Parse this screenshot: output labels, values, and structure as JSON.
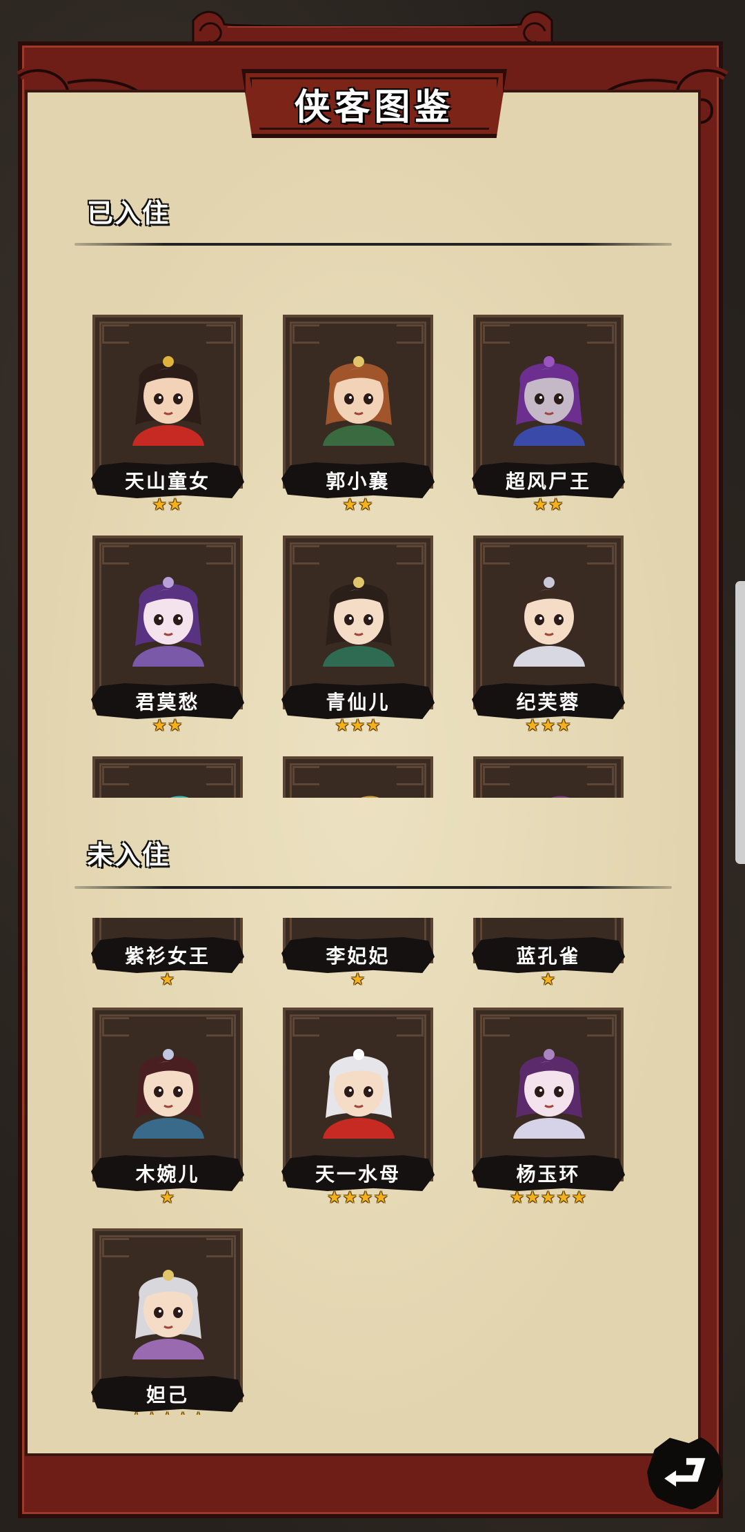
{
  "title": "侠客图鉴",
  "sections": {
    "joined_label": "已入住",
    "not_joined_label": "未入住"
  },
  "joined": [
    {
      "name": "天山童女",
      "stars": "★★",
      "hair": "#2c1d19",
      "skin": "#f3d3b8",
      "cloth": "#c62a23",
      "accent": "#e0b43a"
    },
    {
      "name": "郭小襄",
      "stars": "★★",
      "hair": "#a0552a",
      "skin": "#f3d3b8",
      "cloth": "#3a6a3f",
      "accent": "#e0c56a"
    },
    {
      "name": "超风尸王",
      "stars": "★★",
      "hair": "#6c2f8f",
      "skin": "#c6b9c7",
      "cloth": "#3a4aa8",
      "accent": "#9b55c0"
    },
    {
      "name": "君莫愁",
      "stars": "★★",
      "hair": "#5a3282",
      "skin": "#f4e2ec",
      "cloth": "#7a5aa8",
      "accent": "#b9a0d8"
    },
    {
      "name": "青仙儿",
      "stars": "★★★",
      "hair": "#2b1f1a",
      "skin": "#f5dcc6",
      "cloth": "#2f6b52",
      "accent": "#e0c56a"
    },
    {
      "name": "纪芙蓉",
      "stars": "★★★",
      "hair": "#3a2a22",
      "skin": "#f5dcc6",
      "cloth": "#d8d8e2",
      "accent": "#c8c8d8"
    }
  ],
  "joined_partial": [
    {
      "hair": "#3fb7b5"
    },
    {
      "hair": "#c8a23a"
    },
    {
      "hair": "#7a3b7d"
    }
  ],
  "not_joined_partial": [
    {
      "name": "紫衫女王",
      "stars": "★"
    },
    {
      "name": "李妃妃",
      "stars": "★"
    },
    {
      "name": "蓝孔雀",
      "stars": "★"
    }
  ],
  "not_joined": [
    {
      "name": "木婉儿",
      "stars": "★",
      "hair": "#4a1f22",
      "skin": "#f5dcc6",
      "cloth": "#3a6a8a",
      "accent": "#c0c8e0"
    },
    {
      "name": "天一水母",
      "stars": "★★★★",
      "hair": "#e6e6ea",
      "skin": "#f5dcc6",
      "cloth": "#c62a23",
      "accent": "#ffffff"
    },
    {
      "name": "杨玉环",
      "stars": "★★★★★",
      "hair": "#5a2a6a",
      "skin": "#f4e2ec",
      "cloth": "#d6d3e8",
      "accent": "#a884c0"
    },
    {
      "name": "妲己",
      "stars": "★★★★★",
      "hair": "#d8d8dc",
      "skin": "#f5dcc6",
      "cloth": "#9a6ab0",
      "accent": "#e0c56a"
    }
  ],
  "back_button_icon": "return-arrow-icon"
}
